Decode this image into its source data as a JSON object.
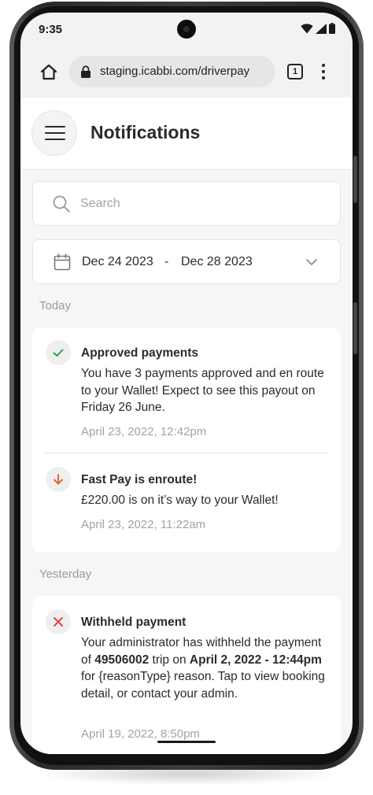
{
  "status_bar": {
    "time": "9:35"
  },
  "browser": {
    "url": "staging.icabbi.com/driverpay",
    "tab_count": "1"
  },
  "header": {
    "title": "Notifications"
  },
  "search": {
    "placeholder": "Search",
    "value": ""
  },
  "date_filter": {
    "from": "Dec 24 2023",
    "separator": "-",
    "to": "Dec 28 2023"
  },
  "sections": [
    {
      "label": "Today",
      "items": [
        {
          "icon": "check-icon",
          "icon_color": "#2e9e4f",
          "title": "Approved payments",
          "body": "You have 3 payments approved and en route to your Wallet! Expect to see this payout on Friday 26 June.",
          "time": "April 23, 2022, 12:42pm"
        },
        {
          "icon": "arrow-down-icon",
          "icon_color": "#e0692e",
          "title": "Fast Pay is enroute!",
          "body": "£220.00 is on it’s way to your Wallet!",
          "time": "April 23, 2022, 11:22am"
        }
      ]
    },
    {
      "label": "Yesterday",
      "items": [
        {
          "icon": "x-icon",
          "icon_color": "#e04848",
          "title": "Withheld payment",
          "body_parts": {
            "p1": "Your administrator has withheld the payment of ",
            "trip": "49506002",
            "p2": " trip on ",
            "date": "April 2, 2022 - 12:44pm",
            "p3": " for {reasonType} reason. Tap to view booking detail, or contact your admin."
          },
          "time": "April 19, 2022, 8:50pm"
        }
      ]
    }
  ]
}
